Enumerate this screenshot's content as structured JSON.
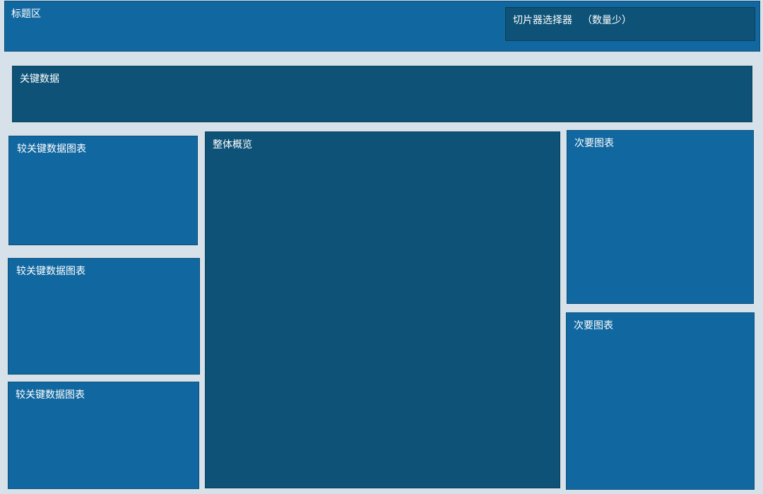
{
  "header": {
    "title": "标题区"
  },
  "slicer": {
    "label": "切片器选择器",
    "note": "（数量少）"
  },
  "key_data": {
    "label": "关键数据"
  },
  "left_charts": [
    {
      "label": "较关键数据图表"
    },
    {
      "label": "较关键数据图表"
    },
    {
      "label": "较关键数据图表"
    }
  ],
  "overview": {
    "label": "整体概览"
  },
  "right_charts": [
    {
      "label": "次要图表"
    },
    {
      "label": "次要图表"
    }
  ],
  "colors": {
    "background": "#d6e1ea",
    "panel_light": "#1168a0",
    "panel_dark": "#0e5377",
    "text": "#ffffff"
  }
}
